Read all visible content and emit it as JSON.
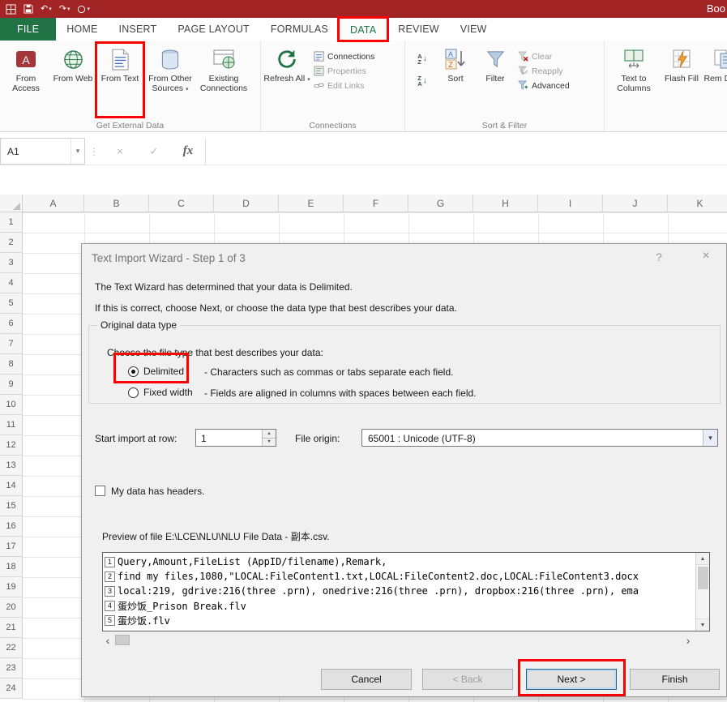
{
  "colors": {
    "titlebar_red": "#a32424",
    "file_tab_green": "#217346",
    "annotation_red": "#ff0000",
    "dialog_bg": "#f0f0f0"
  },
  "icons": {
    "dropdown": "▾",
    "undo": "↶",
    "redo": "↷",
    "cancel_x": "×",
    "check": "✓",
    "fx": "fx",
    "splitter_dots": "⋮",
    "help": "?",
    "close": "×",
    "scroll_up": "▲",
    "scroll_down": "▼",
    "scroll_left": "‹",
    "scroll_right": "›",
    "spin_up": "▲",
    "spin_down": "▼",
    "sort_arrow": "↓",
    "letter_a": "A",
    "letter_z": "Z"
  },
  "titlebar": {
    "workbook_name": "Boo"
  },
  "tabs": {
    "file": "FILE",
    "home": "HOME",
    "insert": "INSERT",
    "page_layout": "PAGE LAYOUT",
    "formulas": "FORMULAS",
    "data": "DATA",
    "review": "REVIEW",
    "view": "VIEW"
  },
  "ribbon": {
    "get_external_data": {
      "label": "Get External Data",
      "from_access": "From Access",
      "from_web": "From Web",
      "from_text": "From Text",
      "from_other_sources": "From Other Sources",
      "existing_connections": "Existing Connections"
    },
    "connections_group": {
      "label": "Connections",
      "refresh_all": "Refresh All",
      "connections": "Connections",
      "properties": "Properties",
      "edit_links": "Edit Links"
    },
    "sort_filter": {
      "label": "Sort & Filter",
      "sort": "Sort",
      "filter": "Filter",
      "clear": "Clear",
      "reapply": "Reapply",
      "advanced": "Advanced"
    },
    "data_tools": {
      "text_to_columns": "Text to Columns",
      "flash_fill": "Flash Fill",
      "remove_duplicates_truncated": "Rem Dupli"
    }
  },
  "formula_bar": {
    "name_box": "A1"
  },
  "grid": {
    "columns": [
      "A",
      "B",
      "C",
      "D",
      "E",
      "F",
      "G",
      "H",
      "I",
      "J",
      "K"
    ],
    "rows": [
      "1",
      "2",
      "3",
      "4",
      "5",
      "6",
      "7",
      "8",
      "9",
      "10",
      "11",
      "12",
      "13",
      "14",
      "15",
      "16",
      "17",
      "18",
      "19",
      "20",
      "21",
      "22",
      "23",
      "24"
    ]
  },
  "dialog": {
    "title": "Text Import Wizard - Step 1 of 3",
    "intro_line1": "The Text Wizard has determined that your data is Delimited.",
    "intro_line2": "If this is correct, choose Next, or choose the data type that best describes your data.",
    "original_data_type": {
      "group_label": "Original data type",
      "prompt": "Choose the file type that best describes your data:",
      "delimited_label": "Delimited",
      "delimited_desc": "- Characters such as commas or tabs separate each field.",
      "fixed_width_label": "Fixed width",
      "fixed_width_desc": "- Fields are aligned in columns with spaces between each field.",
      "selected": "Delimited"
    },
    "start_import_label": "Start import at row:",
    "start_import_value": "1",
    "file_origin_label": "File origin:",
    "file_origin_value": "65001 : Unicode (UTF-8)",
    "headers_checkbox_label": "My data has headers.",
    "headers_checkbox_checked": false,
    "preview": {
      "label": "Preview of file E:\\LCE\\NLU\\NLU File Data - 副本.csv.",
      "lines": [
        {
          "n": "1",
          "text": "Query,Amount,FileList (AppID/filename),Remark,"
        },
        {
          "n": "2",
          "text": "find my files,1080,\"LOCAL:FileContent1.txt,LOCAL:FileContent2.doc,LOCAL:FileContent3.docx"
        },
        {
          "n": "3",
          "text": "local:219, gdrive:216(three .prn), onedrive:216(three .prn), dropbox:216(three .prn), ema"
        },
        {
          "n": "4",
          "text": "蛋炒饭_Prison Break.flv"
        },
        {
          "n": "5",
          "text": "蛋炒饭.flv"
        }
      ]
    },
    "buttons": {
      "cancel": "Cancel",
      "back": "< Back",
      "next": "Next >",
      "finish": "Finish"
    }
  }
}
